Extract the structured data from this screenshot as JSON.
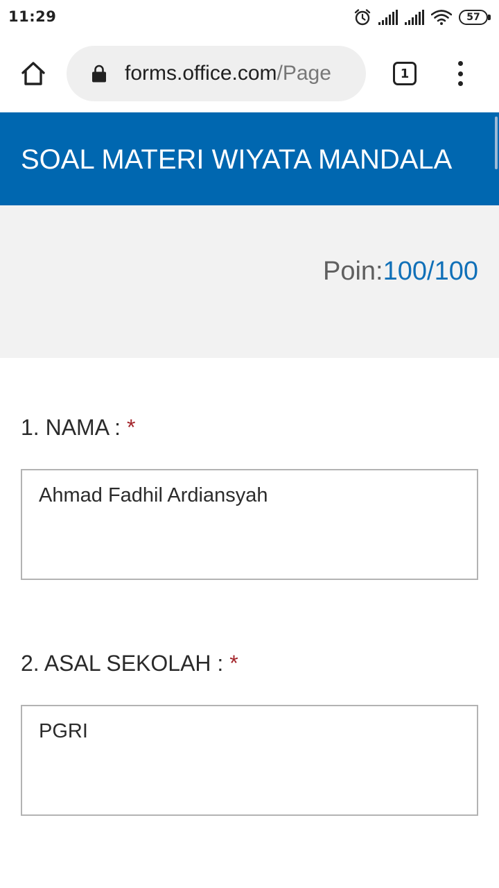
{
  "status_bar": {
    "time": "11:29",
    "battery": "57",
    "icons": [
      "alarm-icon",
      "signal-icon",
      "signal-icon",
      "wifi-icon",
      "battery-icon"
    ]
  },
  "browser": {
    "url_domain": "forms.office.com",
    "url_path": "/Page",
    "tab_count": "1",
    "icons": [
      "home-icon",
      "lock-icon",
      "tabs-icon",
      "more-vert-icon"
    ]
  },
  "form": {
    "title": "SOAL MATERI WIYATA MANDALA",
    "score_label": "Poin:",
    "score_value": "100/100",
    "accent_color": "#0067b0",
    "required_marker": "*",
    "questions": [
      {
        "label": "1. NAMA :",
        "answer": "Ahmad Fadhil Ardiansyah"
      },
      {
        "label": "2. ASAL SEKOLAH :",
        "answer": "PGRI"
      }
    ]
  }
}
